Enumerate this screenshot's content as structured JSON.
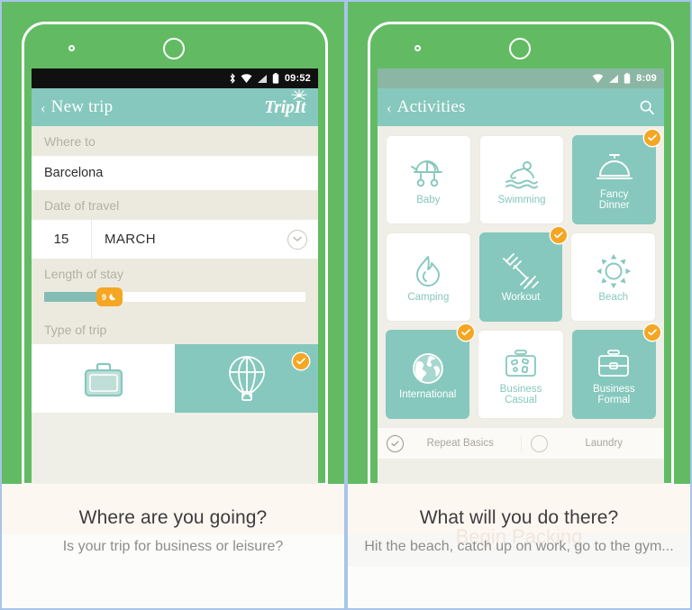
{
  "left_phone": {
    "status_bar": {
      "time": "09:52",
      "icons": [
        "bluetooth-icon",
        "wifi-icon",
        "signal-icon",
        "battery-icon"
      ]
    },
    "app_bar": {
      "back_label": "‹",
      "title": "New trip",
      "logo_text": "TripIt"
    },
    "fields": {
      "where_label": "Where to",
      "where_value": "Barcelona",
      "date_label": "Date of travel",
      "date_day": "15",
      "date_month": "MARCH",
      "length_label": "Length of stay",
      "length_value": "9",
      "length_unit_icon": "moon-icon",
      "type_label": "Type of trip"
    },
    "trip_types": [
      {
        "name": "business",
        "icon": "briefcase-icon",
        "selected": false
      },
      {
        "name": "leisure",
        "icon": "hot-air-balloon-icon",
        "selected": true
      }
    ],
    "caption": {
      "title": "Where are you going?",
      "subtitle": "Is your trip for business or leisure?",
      "ghost": ""
    }
  },
  "right_phone": {
    "status_bar": {
      "time": "8:09",
      "icons": [
        "wifi-icon",
        "signal-icon",
        "battery-icon"
      ]
    },
    "app_bar": {
      "back_label": "‹",
      "title": "Activities",
      "search_icon": "search-icon"
    },
    "activities": [
      [
        {
          "label": "Baby",
          "icon": "stroller-icon",
          "selected": false
        },
        {
          "label": "Swimming",
          "icon": "swimmer-icon",
          "selected": false
        },
        {
          "label": "Fancy\nDinner",
          "icon": "cloche-icon",
          "selected": true
        }
      ],
      [
        {
          "label": "Camping",
          "icon": "campfire-icon",
          "selected": false
        },
        {
          "label": "Workout",
          "icon": "dumbbell-icon",
          "selected": true
        },
        {
          "label": "Beach",
          "icon": "sun-icon",
          "selected": false
        }
      ],
      [
        {
          "label": "International",
          "icon": "globe-icon",
          "selected": true
        },
        {
          "label": "Business\nCasual",
          "icon": "toiletry-bag-icon",
          "selected": false
        },
        {
          "label": "Business\nFormal",
          "icon": "formal-briefcase-icon",
          "selected": true
        }
      ]
    ],
    "bottom_bar": [
      {
        "label": "Repeat Basics",
        "checked": true
      },
      {
        "label": "Laundry",
        "checked": false
      }
    ],
    "caption": {
      "title": "What will you do there?",
      "subtitle": "Hit the beach, catch up on work, go to the gym...",
      "ghost": "Begin Packing"
    }
  },
  "colors": {
    "green_bed": "#62bb63",
    "teal": "#86c8bd",
    "orange": "#f5a623",
    "sage_status": "#8cb6a4",
    "panel_border": "#a8c4ea",
    "form_bg": "#eceadf"
  }
}
